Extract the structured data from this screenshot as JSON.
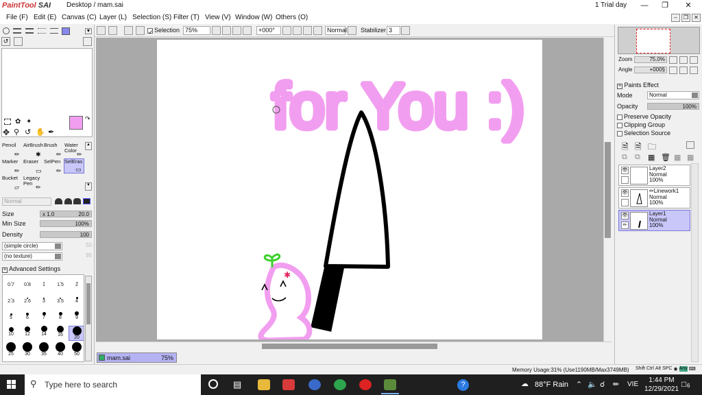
{
  "app": {
    "logo_text": "PaintTool",
    "logo_sai": "SAI",
    "title": "Desktop / mam.sai",
    "trial": "1 Trial day"
  },
  "menu": [
    "File (F)",
    "Edit (E)",
    "Canvas (C)",
    "Layer (L)",
    "Selection (S)",
    "Filter (T)",
    "View (V)",
    "Window (W)",
    "Others (O)"
  ],
  "toolbar": {
    "selection_label": "Selection",
    "zoom": "75%",
    "rotation": "+000°",
    "blend": "Normal",
    "stabilizer_label": "Stabilizer",
    "stabilizer_value": "3"
  },
  "tools": [
    {
      "label": "Pencil",
      "icon": "pencil-icon"
    },
    {
      "label": "AirBrush",
      "icon": "airbrush-icon"
    },
    {
      "label": "Brush",
      "icon": "brush-icon"
    },
    {
      "label": "Water Color",
      "icon": "watercolor-icon"
    },
    {
      "label": "Marker",
      "icon": "marker-icon"
    },
    {
      "label": "Eraser",
      "icon": "eraser-icon"
    },
    {
      "label": "SelPen",
      "icon": "selpen-icon"
    },
    {
      "label": "SelEras",
      "icon": "seleras-icon"
    },
    {
      "label": "Bucket",
      "icon": "bucket-icon"
    },
    {
      "label": "Legacy Pen",
      "icon": "legacy-pen-icon"
    }
  ],
  "tool_props": {
    "mode": "Normal",
    "size_label": "Size",
    "size_mult": "x 1.0",
    "size_value": "20.0",
    "min_size_label": "Min Size",
    "min_size_value": "100%",
    "density_label": "Density",
    "density_value": "100",
    "shape": "(simple circle)",
    "shape_value": "50",
    "texture": "(no texture)",
    "texture_value": "95",
    "advanced": "Advanced Settings"
  },
  "brush_sizes": [
    "0.7",
    "0.8",
    "1",
    "1.5",
    "2",
    "2.3",
    "2.6",
    "3",
    "3.5",
    "4",
    "5",
    "6",
    "7",
    "8",
    "9",
    "10",
    "12",
    "14",
    "16",
    "20",
    "25",
    "30",
    "35",
    "40",
    "50"
  ],
  "selected_brush_size": "20",
  "primary_color": "#f29ef0",
  "canvas": {
    "text": "for You :)"
  },
  "file_tab": {
    "name": "mam.sai",
    "zoom": "75%"
  },
  "navigator": {
    "zoom_label": "Zoom",
    "zoom_value": "75.0%",
    "angle_label": "Angle",
    "angle_value": "+000§"
  },
  "layer_props": {
    "paints_effect": "Paints Effect",
    "mode_label": "Mode",
    "mode_value": "Normal",
    "opacity_label": "Opacity",
    "opacity_value": "100%",
    "preserve_opacity": "Preserve Opacity",
    "clipping_group": "Clipping Group",
    "selection_source": "Selection Source"
  },
  "layers": [
    {
      "name": "Layer2",
      "mode": "Normal",
      "opacity": "100%",
      "selected": false
    },
    {
      "name": "Linework1",
      "mode": "Normal",
      "opacity": "100%",
      "selected": false
    },
    {
      "name": "Layer1",
      "mode": "Normal",
      "opacity": "100%",
      "selected": true
    }
  ],
  "status": {
    "memory": "Memory Usage:31% (Use1190MB/Max3749MB)",
    "keys": [
      "Shift",
      "Ctrl",
      "Alt",
      "SPC",
      "Any"
    ]
  },
  "taskbar": {
    "search_placeholder": "Type here to search",
    "weather": "88°F  Rain",
    "lang": "VIE",
    "time": "1:44 PM",
    "date": "12/29/2021",
    "notif_count": "6"
  }
}
